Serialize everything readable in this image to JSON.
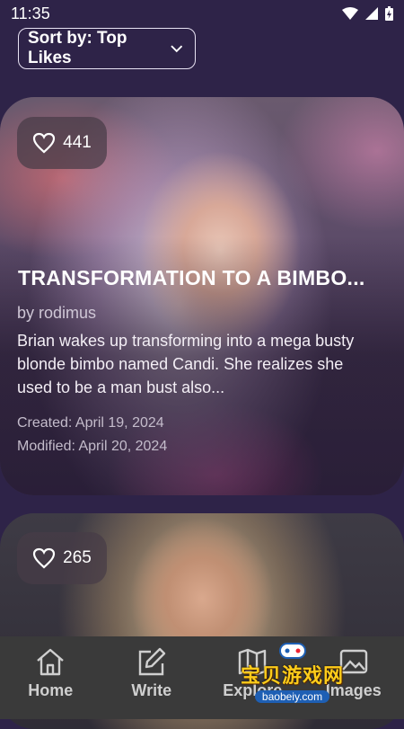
{
  "status": {
    "time": "11:35"
  },
  "sort": {
    "label": "Sort by: Top Likes"
  },
  "cards": [
    {
      "likes": "441",
      "title": "TRANSFORMATION TO A BIMBO...",
      "author": "by rodimus",
      "description": "Brian wakes up transforming into a mega busty blonde bimbo named Candi. She realizes she used to be a man bust also...",
      "created": "Created: April 19, 2024",
      "modified": "Modified: April 20, 2024"
    },
    {
      "likes": "265"
    }
  ],
  "nav": [
    {
      "label": "Home",
      "icon": "home-icon"
    },
    {
      "label": "Write",
      "icon": "edit-icon"
    },
    {
      "label": "Explore",
      "icon": "map-icon"
    },
    {
      "label": "Images",
      "icon": "image-icon"
    }
  ],
  "watermark": {
    "text": "宝贝游戏网",
    "url": "baobeiy.com"
  }
}
